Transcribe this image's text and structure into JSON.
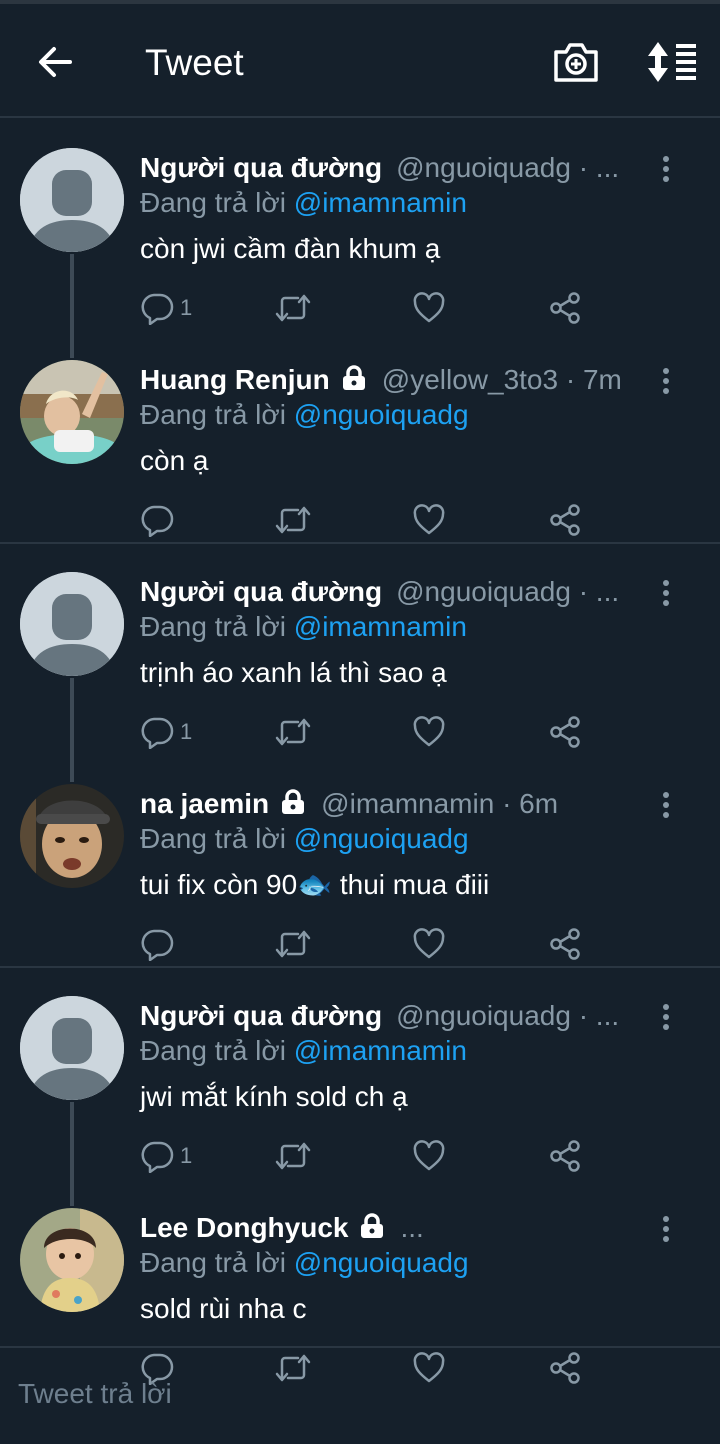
{
  "header": {
    "title": "Tweet"
  },
  "threads": [
    {
      "tweets": [
        {
          "name": "Người qua đường",
          "locked": false,
          "handle": "@nguoiquadg · ...",
          "replying_prefix": "Đang trả lời ",
          "replying_to": "@imamnamin",
          "text": "còn jwi cầm đàn khum ạ",
          "reply_count": "1",
          "avatar": "default"
        },
        {
          "name": "Huang Renjun",
          "locked": true,
          "handle": "@yellow_3to3 · 7m",
          "replying_prefix": "Đang trả lời ",
          "replying_to": "@nguoiquadg",
          "text": "còn ạ",
          "reply_count": "",
          "avatar": "photo-renjun"
        }
      ]
    },
    {
      "tweets": [
        {
          "name": "Người qua đường",
          "locked": false,
          "handle": "@nguoiquadg · ...",
          "replying_prefix": "Đang trả lời ",
          "replying_to": "@imamnamin",
          "text": "trịnh áo xanh lá thì sao ạ",
          "reply_count": "1",
          "avatar": "default"
        },
        {
          "name": "na jaemin",
          "locked": true,
          "handle": "@imamnamin · 6m",
          "replying_prefix": "Đang trả lời ",
          "replying_to": "@nguoiquadg",
          "text": "tui fix còn 90🐟 thui mua điii",
          "reply_count": "",
          "avatar": "photo-jaemin"
        }
      ]
    },
    {
      "tweets": [
        {
          "name": "Người qua đường",
          "locked": false,
          "handle": "@nguoiquadg · ...",
          "replying_prefix": "Đang trả lời ",
          "replying_to": "@imamnamin",
          "text": "jwi mắt kính sold ch ạ",
          "reply_count": "1",
          "avatar": "default"
        },
        {
          "name": "Lee Donghyuck",
          "locked": true,
          "handle": "...",
          "replying_prefix": "Đang trả lời ",
          "replying_to": "@nguoiquadg",
          "text": "sold rùi nha c",
          "reply_count": "",
          "avatar": "photo-donghyuck"
        }
      ]
    }
  ],
  "composer": {
    "placeholder": "Tweet trả lời"
  },
  "colors": {
    "background": "#15202b",
    "mention": "#1da1f2",
    "muted": "#8899a6",
    "separator": "#2a3642"
  },
  "icons": [
    "back-arrow-icon",
    "camera-plus-icon",
    "sort-icon",
    "more-vertical-icon",
    "reply-icon",
    "retweet-icon",
    "like-icon",
    "share-icon",
    "lock-icon"
  ]
}
